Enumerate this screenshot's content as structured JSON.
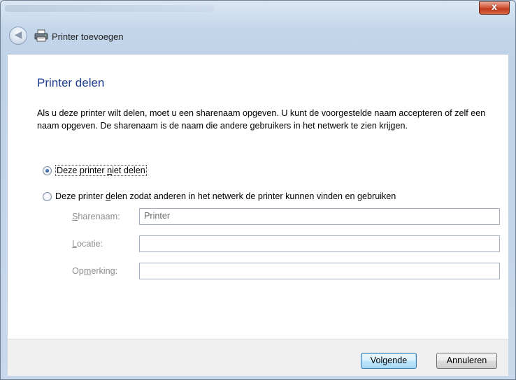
{
  "titlebar": {
    "close_label": "x"
  },
  "header": {
    "title": "Printer toevoegen",
    "back_icon": "back-arrow-icon",
    "printer_icon": "printer-icon"
  },
  "main": {
    "page_title": "Printer delen",
    "description": "Als u deze printer wilt delen, moet u een sharenaam opgeven. U kunt de voorgestelde naam accepteren of zelf een naam opgeven. De sharenaam is de naam die andere gebruikers in het netwerk te zien krijgen.",
    "option_no_share": {
      "pre": "Deze printer ",
      "accel": "n",
      "post": "iet delen",
      "checked": true
    },
    "option_share": {
      "pre": "Deze printer ",
      "accel": "d",
      "post": "elen zodat anderen in het netwerk de printer kunnen vinden en gebruiken",
      "checked": false
    },
    "fields": {
      "sharename": {
        "accel": "S",
        "rest": "harenaam:",
        "value": "Printer"
      },
      "location": {
        "accel": "L",
        "rest": "ocatie:",
        "value": ""
      },
      "comment": {
        "pre": "Op",
        "accel": "m",
        "rest": "erking:",
        "value": ""
      }
    }
  },
  "footer": {
    "next_label": "Volgende",
    "cancel_label": "Annuleren"
  },
  "colors": {
    "title_blue": "#1e3d8f",
    "close_red": "#c2391c",
    "default_button_blue": "#a7d9f5"
  }
}
